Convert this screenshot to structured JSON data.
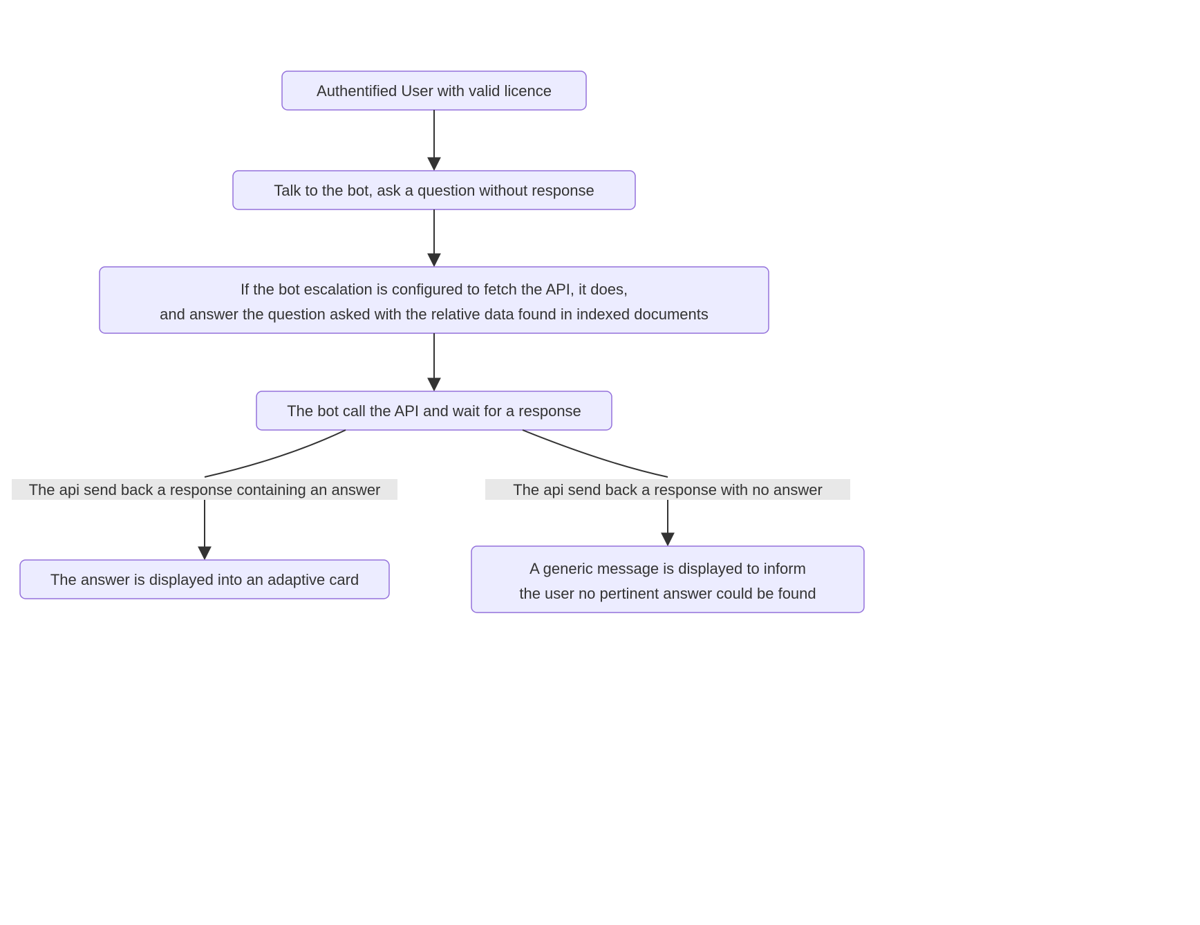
{
  "nodes": {
    "n1": {
      "text": "Authentified User with valid licence"
    },
    "n2": {
      "text": "Talk to the bot, ask a question without response"
    },
    "n3": {
      "line1": "If the bot escalation is configured to fetch the API, it does,",
      "line2": "and answer the question asked with the relative data found in indexed documents"
    },
    "n4": {
      "text": "The bot call the API and wait for a response"
    },
    "n5": {
      "text": "The answer is displayed into an adaptive card"
    },
    "n6": {
      "line1": "A generic message is displayed to inform",
      "line2": "the user no pertinent answer could be found"
    }
  },
  "edges": {
    "e45": {
      "label": "The api send back a response containing an answer"
    },
    "e46": {
      "label": "The api send back a response with no answer"
    }
  }
}
